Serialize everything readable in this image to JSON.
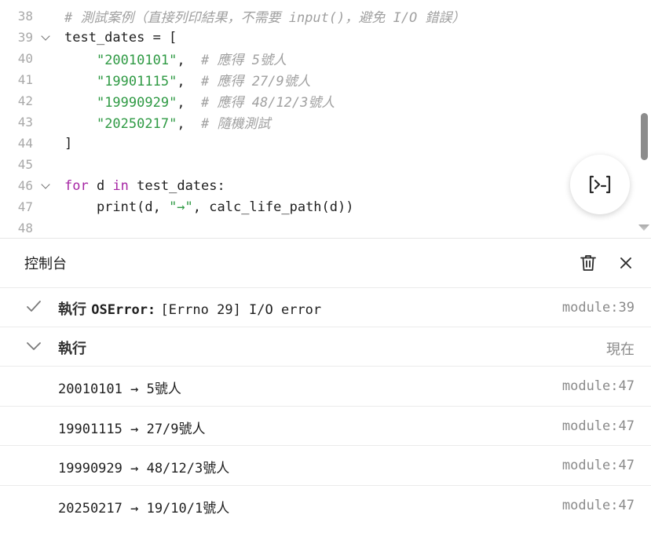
{
  "editor": {
    "lines": [
      {
        "num": "38",
        "fold": false,
        "tokens": [
          {
            "t": "com",
            "v": "# 測試案例（直接列印結果，不需要 input()，避免 I/O 錯誤）"
          }
        ]
      },
      {
        "num": "39",
        "fold": true,
        "tokens": [
          {
            "t": "plain",
            "v": "test_dates = ["
          }
        ]
      },
      {
        "num": "40",
        "fold": false,
        "tokens": [
          {
            "t": "plain",
            "v": "    "
          },
          {
            "t": "str",
            "v": "\"20010101\""
          },
          {
            "t": "plain",
            "v": ",  "
          },
          {
            "t": "com",
            "v": "# 應得 5號人"
          }
        ]
      },
      {
        "num": "41",
        "fold": false,
        "tokens": [
          {
            "t": "plain",
            "v": "    "
          },
          {
            "t": "str",
            "v": "\"19901115\""
          },
          {
            "t": "plain",
            "v": ",  "
          },
          {
            "t": "com",
            "v": "# 應得 27/9號人"
          }
        ]
      },
      {
        "num": "42",
        "fold": false,
        "tokens": [
          {
            "t": "plain",
            "v": "    "
          },
          {
            "t": "str",
            "v": "\"19990929\""
          },
          {
            "t": "plain",
            "v": ",  "
          },
          {
            "t": "com",
            "v": "# 應得 48/12/3號人"
          }
        ]
      },
      {
        "num": "43",
        "fold": false,
        "tokens": [
          {
            "t": "plain",
            "v": "    "
          },
          {
            "t": "str",
            "v": "\"20250217\""
          },
          {
            "t": "plain",
            "v": ",  "
          },
          {
            "t": "com",
            "v": "# 隨機測試"
          }
        ]
      },
      {
        "num": "44",
        "fold": false,
        "tokens": [
          {
            "t": "plain",
            "v": "]"
          }
        ]
      },
      {
        "num": "45",
        "fold": false,
        "tokens": []
      },
      {
        "num": "46",
        "fold": true,
        "tokens": [
          {
            "t": "kw",
            "v": "for"
          },
          {
            "t": "plain",
            "v": " d "
          },
          {
            "t": "kw",
            "v": "in"
          },
          {
            "t": "plain",
            "v": " test_dates:"
          }
        ]
      },
      {
        "num": "47",
        "fold": false,
        "tokens": [
          {
            "t": "plain",
            "v": "    print(d, "
          },
          {
            "t": "str",
            "v": "\"→\""
          },
          {
            "t": "plain",
            "v": ", calc_life_path(d))"
          }
        ]
      },
      {
        "num": "48",
        "fold": false,
        "tokens": []
      }
    ],
    "fab_icon": "run-code-icon"
  },
  "console": {
    "title": "控制台",
    "clear_icon": "trash-icon",
    "close_icon": "close-icon",
    "error_entry": {
      "label": "執行",
      "error_name": "OSError:",
      "error_message": "[Errno 29] I/O error",
      "location": "module:39"
    },
    "run_entry": {
      "label": "執行",
      "time": "現在"
    },
    "outputs": [
      {
        "text": "20010101 → 5號人",
        "location": "module:47"
      },
      {
        "text": "19901115 → 27/9號人",
        "location": "module:47"
      },
      {
        "text": "19990929 → 48/12/3號人",
        "location": "module:47"
      },
      {
        "text": "20250217 → 19/10/1號人",
        "location": "module:47"
      }
    ]
  }
}
